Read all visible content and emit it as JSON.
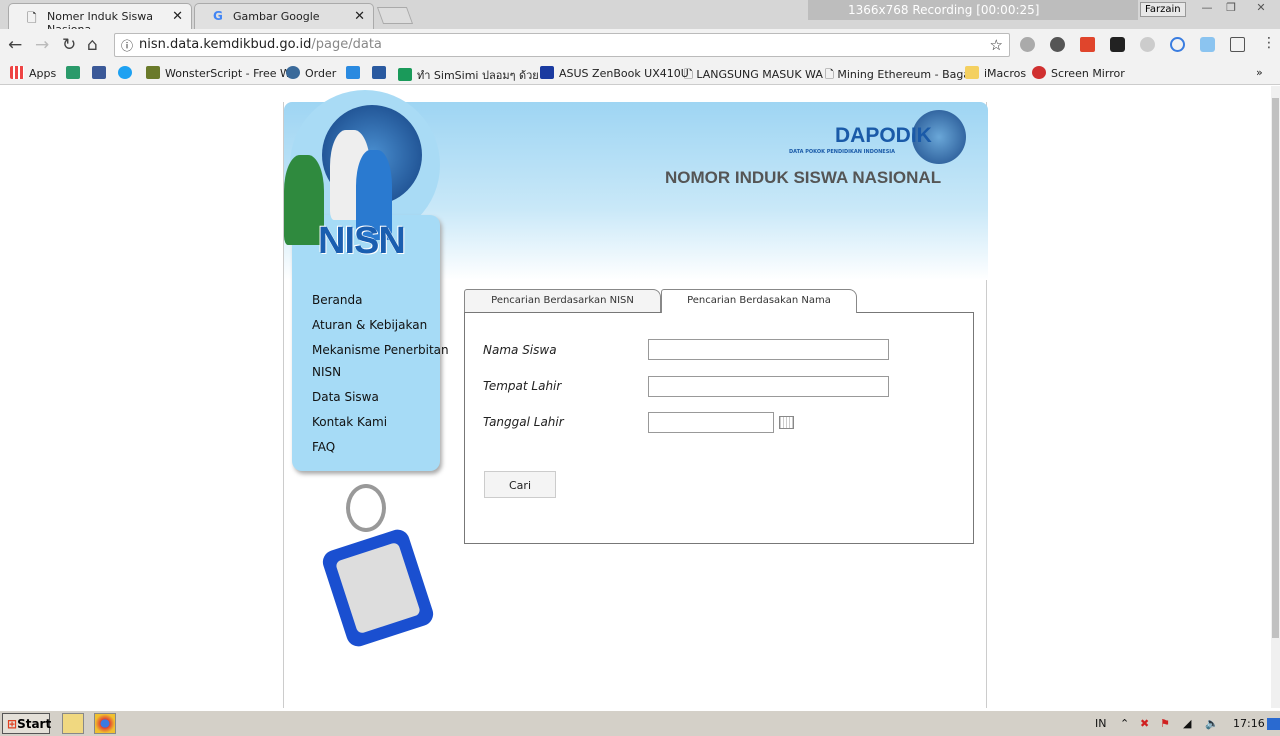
{
  "browser": {
    "tabs": [
      {
        "label": "Nomer Induk Siswa Nasiona",
        "icon": "page-icon",
        "active": true
      },
      {
        "label": "Gambar Google",
        "icon": "google-icon",
        "active": false
      }
    ],
    "recording": "1366x768  Recording [00:00:25]",
    "user": "Farzain",
    "url_host": "nisn.data.kemdikbud.go.id",
    "url_path": "/page/data",
    "bookmarks": [
      "Apps",
      "WonsterScript - Free W",
      "Order",
      "ทำ SimSimi ปลอมๆ ด้วย L",
      "ASUS ZenBook UX410U",
      "LANGSUNG MASUK WA",
      "Mining Ethereum - Baga",
      "iMacros",
      "Screen Mirror"
    ]
  },
  "page": {
    "logo_text": "NISN",
    "brand": "DAPODIK",
    "brand_sub": "DATA POKOK PENDIDIKAN  INDONESIA",
    "title": "NOMOR INDUK SISWA NASIONAL",
    "menu": [
      "Beranda",
      "Aturan & Kebijakan",
      "Mekanisme Penerbitan",
      "NISN",
      "Data Siswa",
      "Kontak Kami",
      "FAQ"
    ],
    "tabs": [
      "Pencarian Berdasarkan NISN",
      "Pencarian Berdasakan Nama"
    ],
    "active_tab": 1,
    "form": {
      "nama_label": "Nama Siswa",
      "tempat_label": "Tempat Lahir",
      "tanggal_label": "Tanggal Lahir",
      "nama_value": "",
      "tempat_value": "",
      "tanggal_value": "",
      "submit": "Cari"
    }
  },
  "taskbar": {
    "start": "Start",
    "lang": "IN",
    "time": "17:16"
  }
}
